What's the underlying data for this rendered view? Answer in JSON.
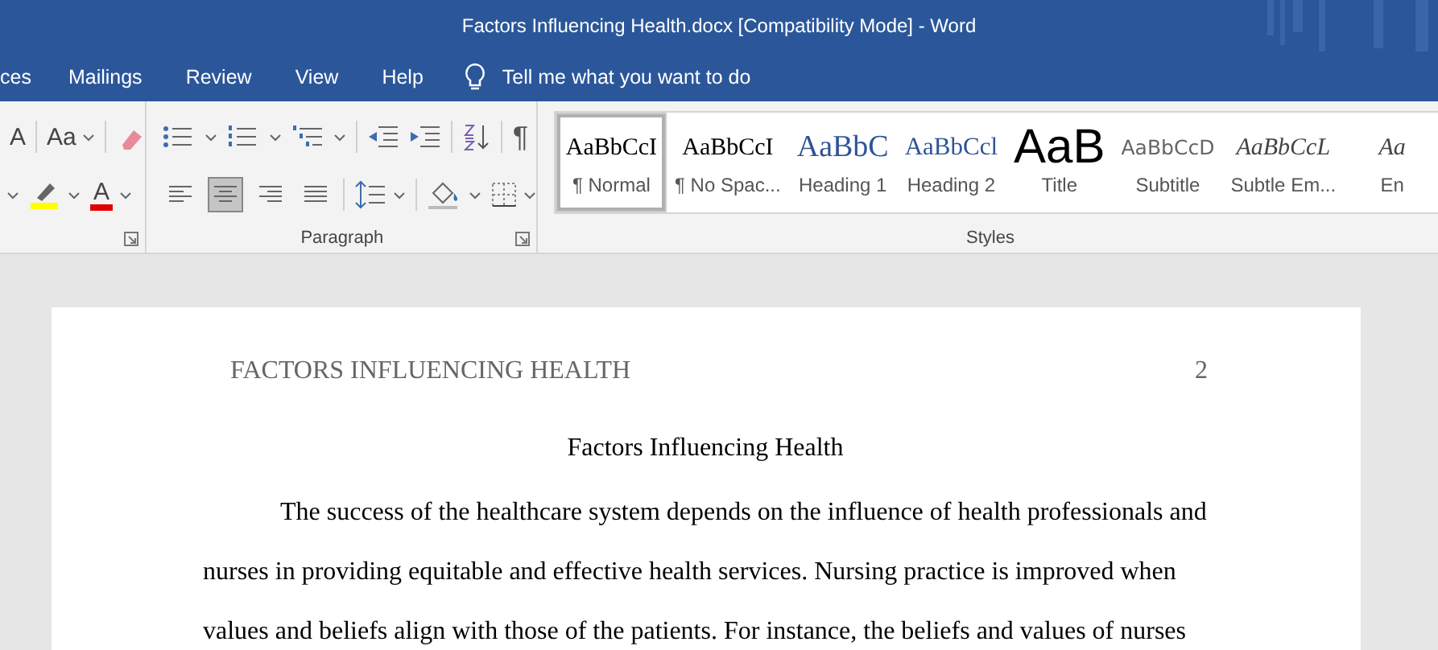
{
  "window": {
    "title": "Factors Influencing Health.docx [Compatibility Mode]  -  Word"
  },
  "tabs": [
    {
      "label": "ces",
      "selected": false
    },
    {
      "label": "Mailings",
      "selected": false
    },
    {
      "label": "Review",
      "selected": false
    },
    {
      "label": "View",
      "selected": false
    },
    {
      "label": "Help",
      "selected": false
    }
  ],
  "tell_me": {
    "placeholder": "Tell me what you want to do"
  },
  "font_group": {
    "grow_font": "A",
    "change_case": "Aa",
    "font_color": "A"
  },
  "paragraph_group": {
    "label": "Paragraph",
    "show_marks": "¶",
    "alignments": [
      {
        "kind": "left",
        "selected": false
      },
      {
        "kind": "center",
        "selected": true
      },
      {
        "kind": "right",
        "selected": false
      },
      {
        "kind": "justify",
        "selected": false
      }
    ]
  },
  "styles_group": {
    "label": "Styles",
    "styles": [
      {
        "sample": "AaBbCcI",
        "label": "¶ Normal",
        "kind": "normal",
        "selected": true
      },
      {
        "sample": "AaBbCcI",
        "label": "¶ No Spac...",
        "kind": "normal",
        "selected": false
      },
      {
        "sample": "AaBbC",
        "label": "Heading 1",
        "kind": "heading1",
        "selected": false
      },
      {
        "sample": "AaBbCcl",
        "label": "Heading 2",
        "kind": "heading2",
        "selected": false
      },
      {
        "sample": "AaB",
        "label": "Title",
        "kind": "title",
        "selected": false
      },
      {
        "sample": "AaBbCcD",
        "label": "Subtitle",
        "kind": "subtitle",
        "selected": false
      },
      {
        "sample": "AaBbCcL",
        "label": "Subtle Em...",
        "kind": "emphasis",
        "selected": false
      },
      {
        "sample": "Aa",
        "label": "En",
        "kind": "emphasis",
        "selected": false
      }
    ]
  },
  "document": {
    "running_head": "FACTORS INFLUENCING HEALTH",
    "page_number": "2",
    "title": "Factors Influencing Health",
    "paragraph": "The success of the healthcare system depends on the influence of health professionals and nurses in providing equitable and effective health services. Nursing practice is improved when values and beliefs align with those of the patients. For instance, the beliefs and values of nurses"
  }
}
